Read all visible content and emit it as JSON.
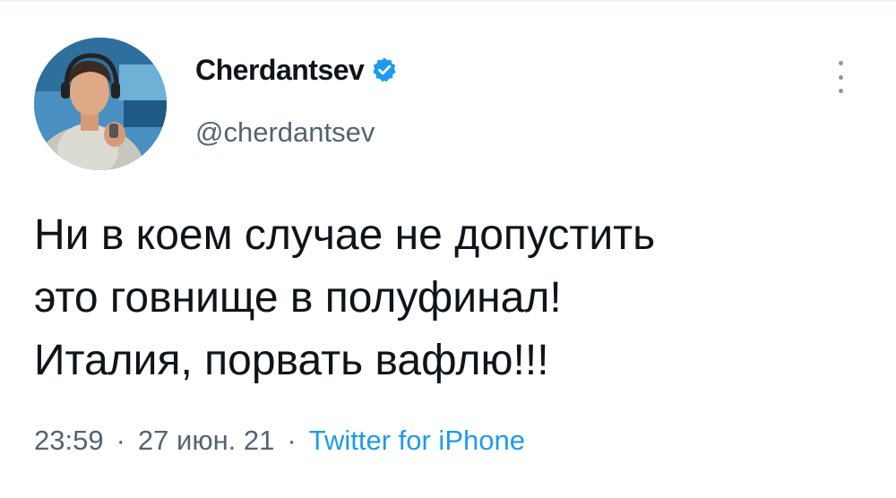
{
  "author": {
    "display_name": "Cherdantsev",
    "handle": "@cherdantsev",
    "verified": true
  },
  "icons": {
    "verified": "verified-badge-icon",
    "more": "more-vertical-icon"
  },
  "tweet": {
    "lines": [
      "Ни в коем случае не допустить",
      "это говнище в полуфинал!",
      "Италия, порвать вафлю!!!"
    ]
  },
  "meta": {
    "time": "23:59",
    "date": "27 июн. 21",
    "separator": "·",
    "source": "Twitter for iPhone"
  },
  "colors": {
    "accent": "#1d9bf0",
    "text": "#0f1419",
    "secondary": "#536471"
  }
}
